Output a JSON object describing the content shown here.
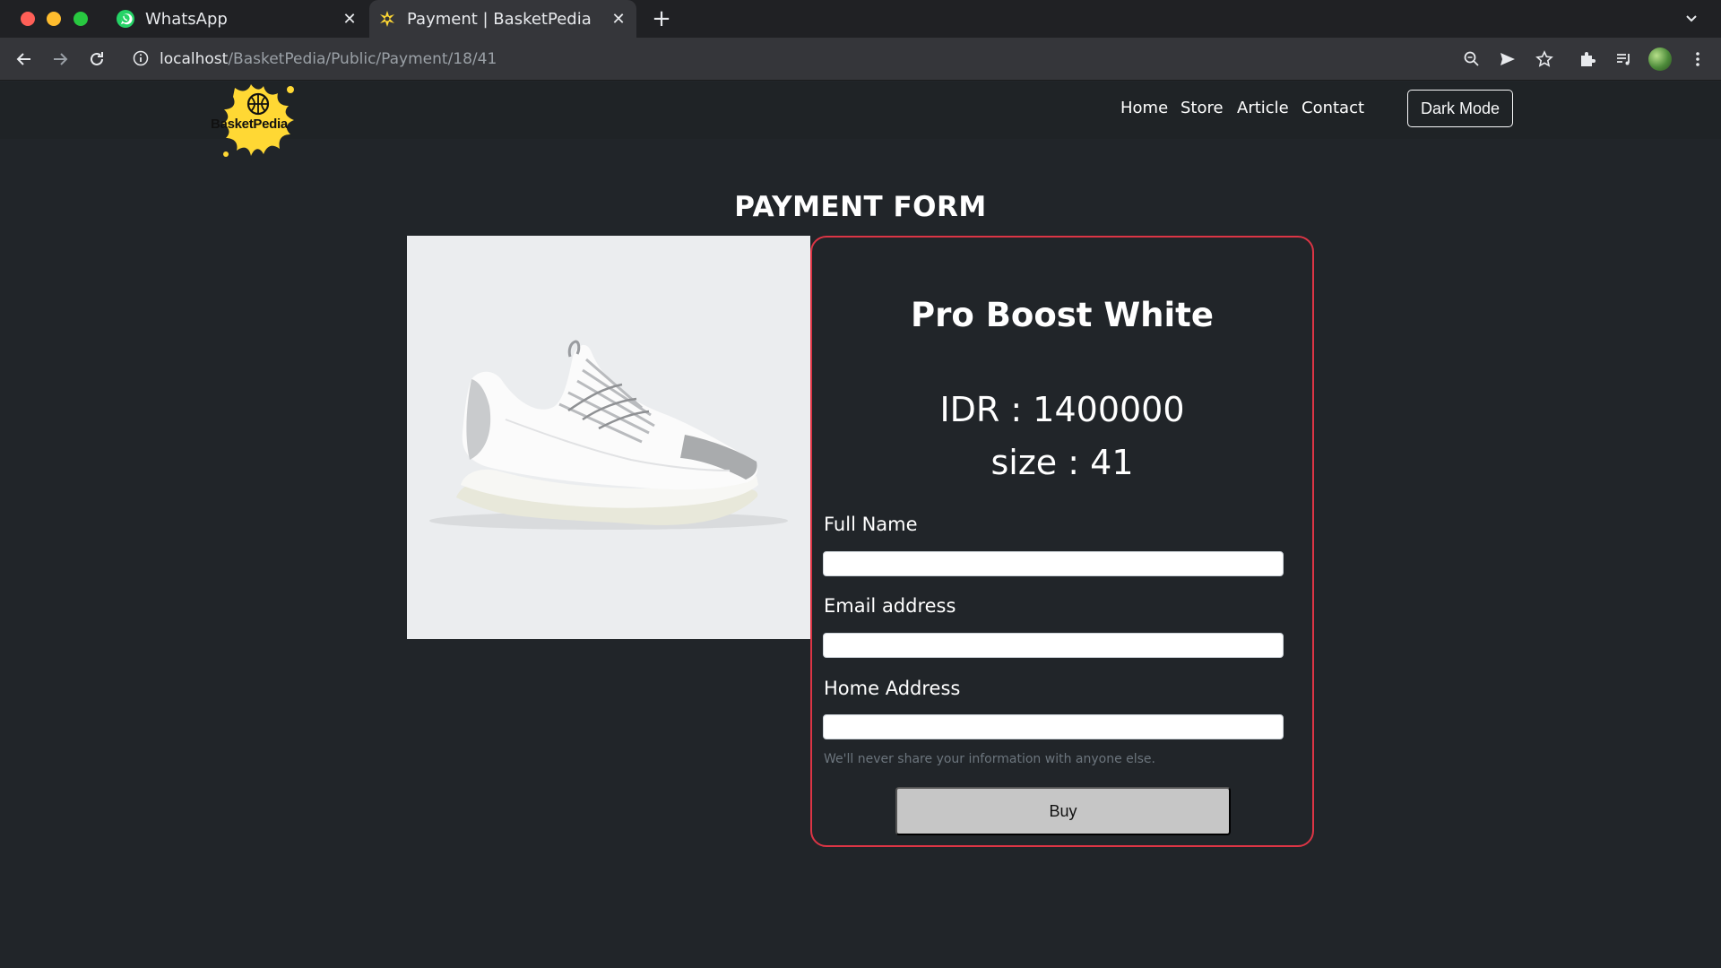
{
  "browser": {
    "tabs": [
      {
        "title": "WhatsApp",
        "active": false,
        "icon": "whatsapp-icon"
      },
      {
        "title": "Payment | BasketPedia",
        "active": true,
        "icon": "basketpedia-favicon"
      }
    ],
    "url_host": "localhost",
    "url_path": "/BasketPedia/Public/Payment/18/41"
  },
  "site": {
    "logo_text": "BasketPedia",
    "nav": [
      "Home",
      "Store",
      "Article",
      "Contact"
    ],
    "dark_mode_label": "Dark Mode"
  },
  "page": {
    "title": "PAYMENT FORM",
    "product_name": "Pro Boost White",
    "price": "IDR : 1400000",
    "size": "size : 41",
    "fields": [
      {
        "label": "Full Name",
        "value": ""
      },
      {
        "label": "Email address",
        "value": ""
      },
      {
        "label": "Home Address",
        "value": ""
      }
    ],
    "help_text": "We'll never share your information with anyone else.",
    "buy_label": "Buy"
  },
  "colors": {
    "page_bg": "#212529",
    "card_border": "#dc3545",
    "logo_yellow": "#ffd834",
    "buy_button": "#c6c6c6"
  }
}
